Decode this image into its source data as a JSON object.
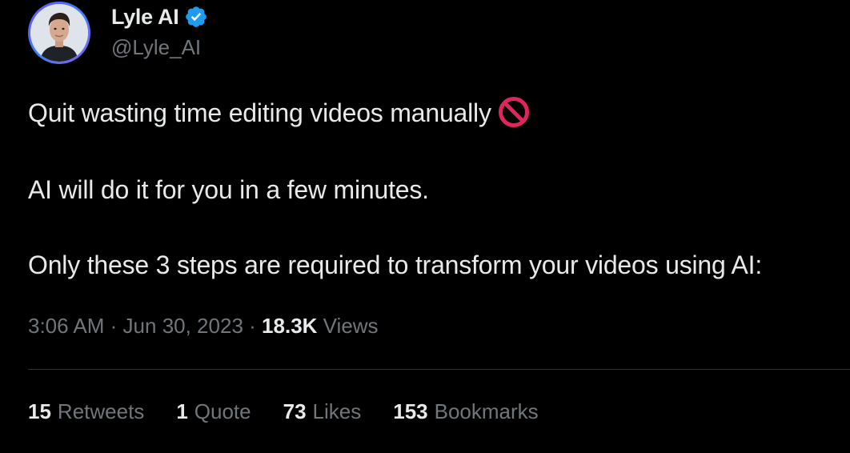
{
  "author": {
    "display_name": "Lyle AI",
    "handle": "@Lyle_AI",
    "verified_badge_icon": "verified-badge-icon",
    "verified_color": "#1d9bf0"
  },
  "tweet": {
    "lines": [
      "Quit wasting time editing videos manually",
      "AI will do it for you in a few minutes.",
      "Only these 3 steps are required to transform your videos using AI:"
    ],
    "emoji_icon": "prohibited-icon"
  },
  "meta": {
    "time": "3:06 AM",
    "separator": "·",
    "date": "Jun 30, 2023",
    "views_count": "18.3K",
    "views_label": "Views"
  },
  "stats": {
    "retweets": {
      "count": "15",
      "label": "Retweets"
    },
    "quotes": {
      "count": "1",
      "label": "Quote"
    },
    "likes": {
      "count": "73",
      "label": "Likes"
    },
    "bookmarks": {
      "count": "153",
      "label": "Bookmarks"
    }
  },
  "colors": {
    "background": "#000000",
    "primary_text": "#e7e9ea",
    "secondary_text": "#71767b",
    "divider": "#2f3336",
    "prohibited_red": "#e0245e"
  }
}
